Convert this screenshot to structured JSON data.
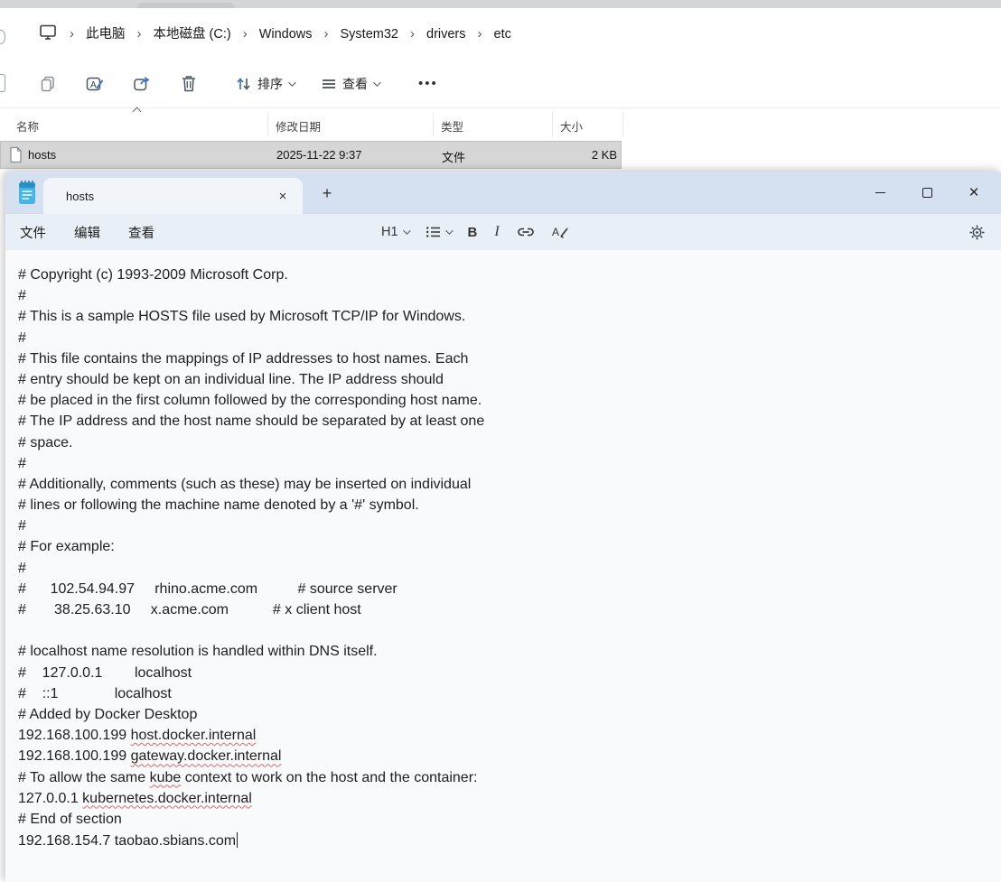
{
  "colors": {
    "titlebar": "#d5e1f0",
    "menubar": "#e9eff6",
    "editor_bg": "#f8fafc",
    "selected_row": "#d6d6d6",
    "squiggle_red": "#d66a66",
    "accent_blue": "#3b6fb5"
  },
  "explorer": {
    "breadcrumb": {
      "items": [
        "此电脑",
        "本地磁盘 (C:)",
        "Windows",
        "System32",
        "drivers",
        "etc"
      ],
      "separator_glyph": "›"
    },
    "toolbar": {
      "sort_label": "排序",
      "view_label": "查看",
      "more_glyph": "•••"
    },
    "columns": [
      {
        "label": "名称"
      },
      {
        "label": "修改日期"
      },
      {
        "label": "类型"
      },
      {
        "label": "大小"
      }
    ],
    "rows": [
      {
        "name": "hosts",
        "date": "2025-11-22 9:37",
        "type": "文件",
        "size": "2 KB"
      }
    ]
  },
  "notepad": {
    "tab": {
      "title": "hosts",
      "close_glyph": "×",
      "new_tab_glyph": "+"
    },
    "window_controls": {
      "close_glyph": "×"
    },
    "menus": [
      "文件",
      "编辑",
      "查看"
    ],
    "format_toolbar": {
      "heading_label": "H1",
      "bold_glyph": "B",
      "italic_glyph": "I"
    },
    "editor": {
      "lines": [
        "# Copyright (c) 1993-2009 Microsoft Corp.",
        "#",
        "# This is a sample HOSTS file used by Microsoft TCP/IP for Windows.",
        "#",
        "# This file contains the mappings of IP addresses to host names. Each",
        "# entry should be kept on an individual line. The IP address should",
        "# be placed in the first column followed by the corresponding host name.",
        "# The IP address and the host name should be separated by at least one",
        "# space.",
        "#",
        "# Additionally, comments (such as these) may be inserted on individual",
        "# lines or following the machine name denoted by a '#' symbol.",
        "#",
        "# For example:",
        "#",
        "#      102.54.94.97     rhino.acme.com          # source server",
        "#       38.25.63.10     x.acme.com           # x client host",
        "",
        "# localhost name resolution is handled within DNS itself.",
        "#    127.0.0.1        localhost",
        "#    ::1              localhost",
        "# Added by Docker Desktop",
        {
          "segments": [
            {
              "t": "192.168.100.199 "
            },
            {
              "t": "host.docker.internal",
              "u": true
            }
          ]
        },
        {
          "segments": [
            {
              "t": "192.168.100.199 "
            },
            {
              "t": "gateway.docker.internal",
              "u": true
            }
          ]
        },
        {
          "segments": [
            {
              "t": "# To allow the same "
            },
            {
              "t": "kube",
              "u": true
            },
            {
              "t": " context to work on the host and the container:"
            }
          ]
        },
        {
          "segments": [
            {
              "t": "127.0.0.1 "
            },
            {
              "t": "kubernetes.docker.internal",
              "u": true
            }
          ]
        },
        "# End of section",
        {
          "segments": [
            {
              "t": "192.168.154.7 taobao.sbians.com"
            }
          ],
          "caret": true
        }
      ]
    }
  }
}
